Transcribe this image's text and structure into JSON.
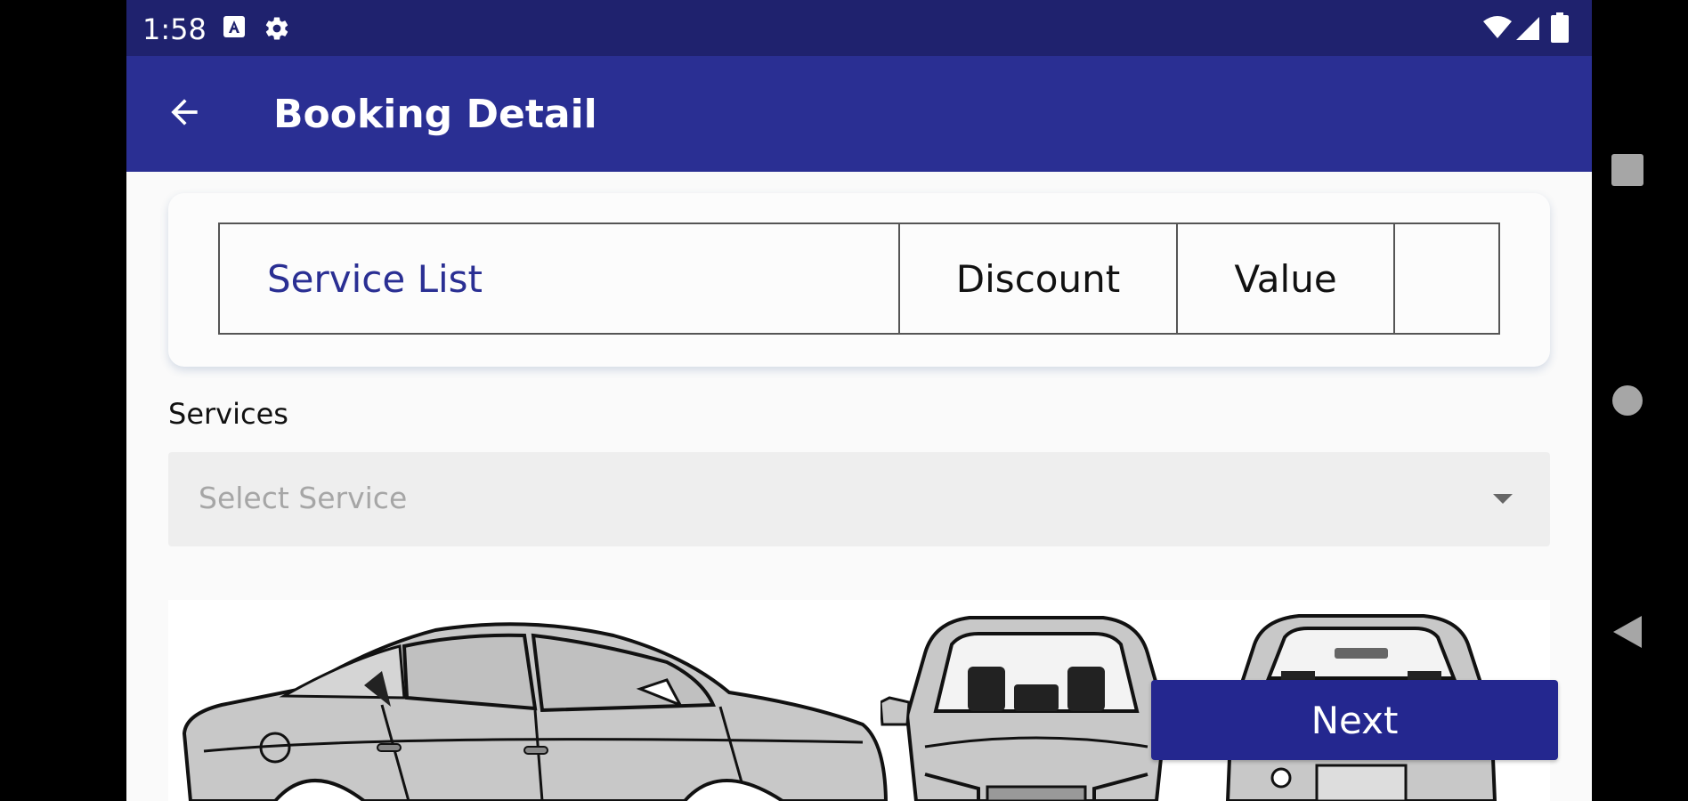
{
  "status_bar": {
    "time": "1:58",
    "icons": [
      "a-notification-icon",
      "settings-icon",
      "wifi-icon",
      "cellular-signal-icon",
      "battery-icon"
    ]
  },
  "app_bar": {
    "back_icon": "arrow-back-icon",
    "title": "Booking Detail"
  },
  "service_table": {
    "columns": [
      "Service List",
      "Discount",
      "Value",
      ""
    ]
  },
  "services": {
    "label": "Services",
    "placeholder": "Select Service",
    "arrow_icon": "dropdown-arrow-icon"
  },
  "car_diagram": {
    "views": [
      "car-side-view-icon",
      "car-front-view-icon",
      "car-rear-view-icon"
    ]
  },
  "next_button": {
    "label": "Next"
  },
  "nav_bar": {
    "icons": [
      "recents-icon",
      "home-icon",
      "back-icon"
    ]
  },
  "colors": {
    "status_bar": "#1f226e",
    "app_bar": "#2a2f93",
    "accent_text": "#2a2f93",
    "next_button": "#24278f",
    "car_fill": "#c8c8c8"
  }
}
